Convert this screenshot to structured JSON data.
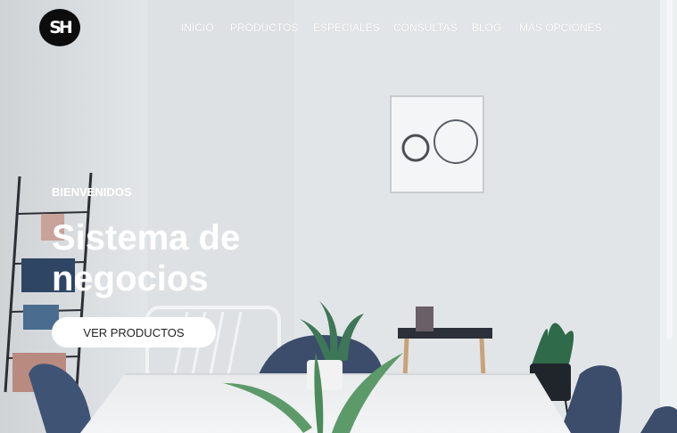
{
  "brand": {
    "logo_text": "SH"
  },
  "nav": {
    "items": [
      {
        "label": "INICIO"
      },
      {
        "label": "PRODUCTOS"
      },
      {
        "label": "ESPECIALES"
      },
      {
        "label": "CONSULTAS"
      },
      {
        "label": "BLOG"
      },
      {
        "label": "MÁS OPCIONES"
      }
    ],
    "more_chevron": "chevron-down-icon"
  },
  "hero": {
    "eyebrow": "BIENVENIDOS",
    "title": "Sistema de negocios",
    "cta_label": "VER PRODUCTOS"
  },
  "colors": {
    "text": "#ffffff",
    "logo_bg": "#0d0d0d",
    "cta_bg": "#ffffff",
    "cta_text": "#222222",
    "wall": "#dde0e2",
    "chair": "#3b4d6b"
  }
}
